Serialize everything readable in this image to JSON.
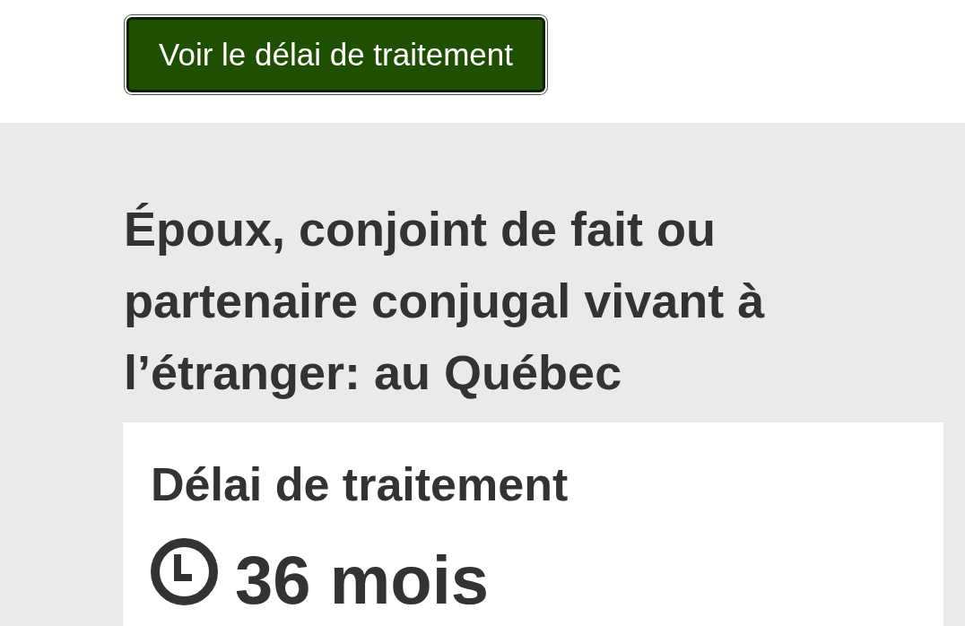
{
  "button": {
    "label": "Voir le délai de traitement",
    "focused": true
  },
  "result": {
    "title": "Époux, conjoint de fait ou partenaire conjugal vivant à l’étranger: au Québec",
    "card": {
      "heading": "Délai de traitement",
      "duration": "36 mois"
    }
  }
}
